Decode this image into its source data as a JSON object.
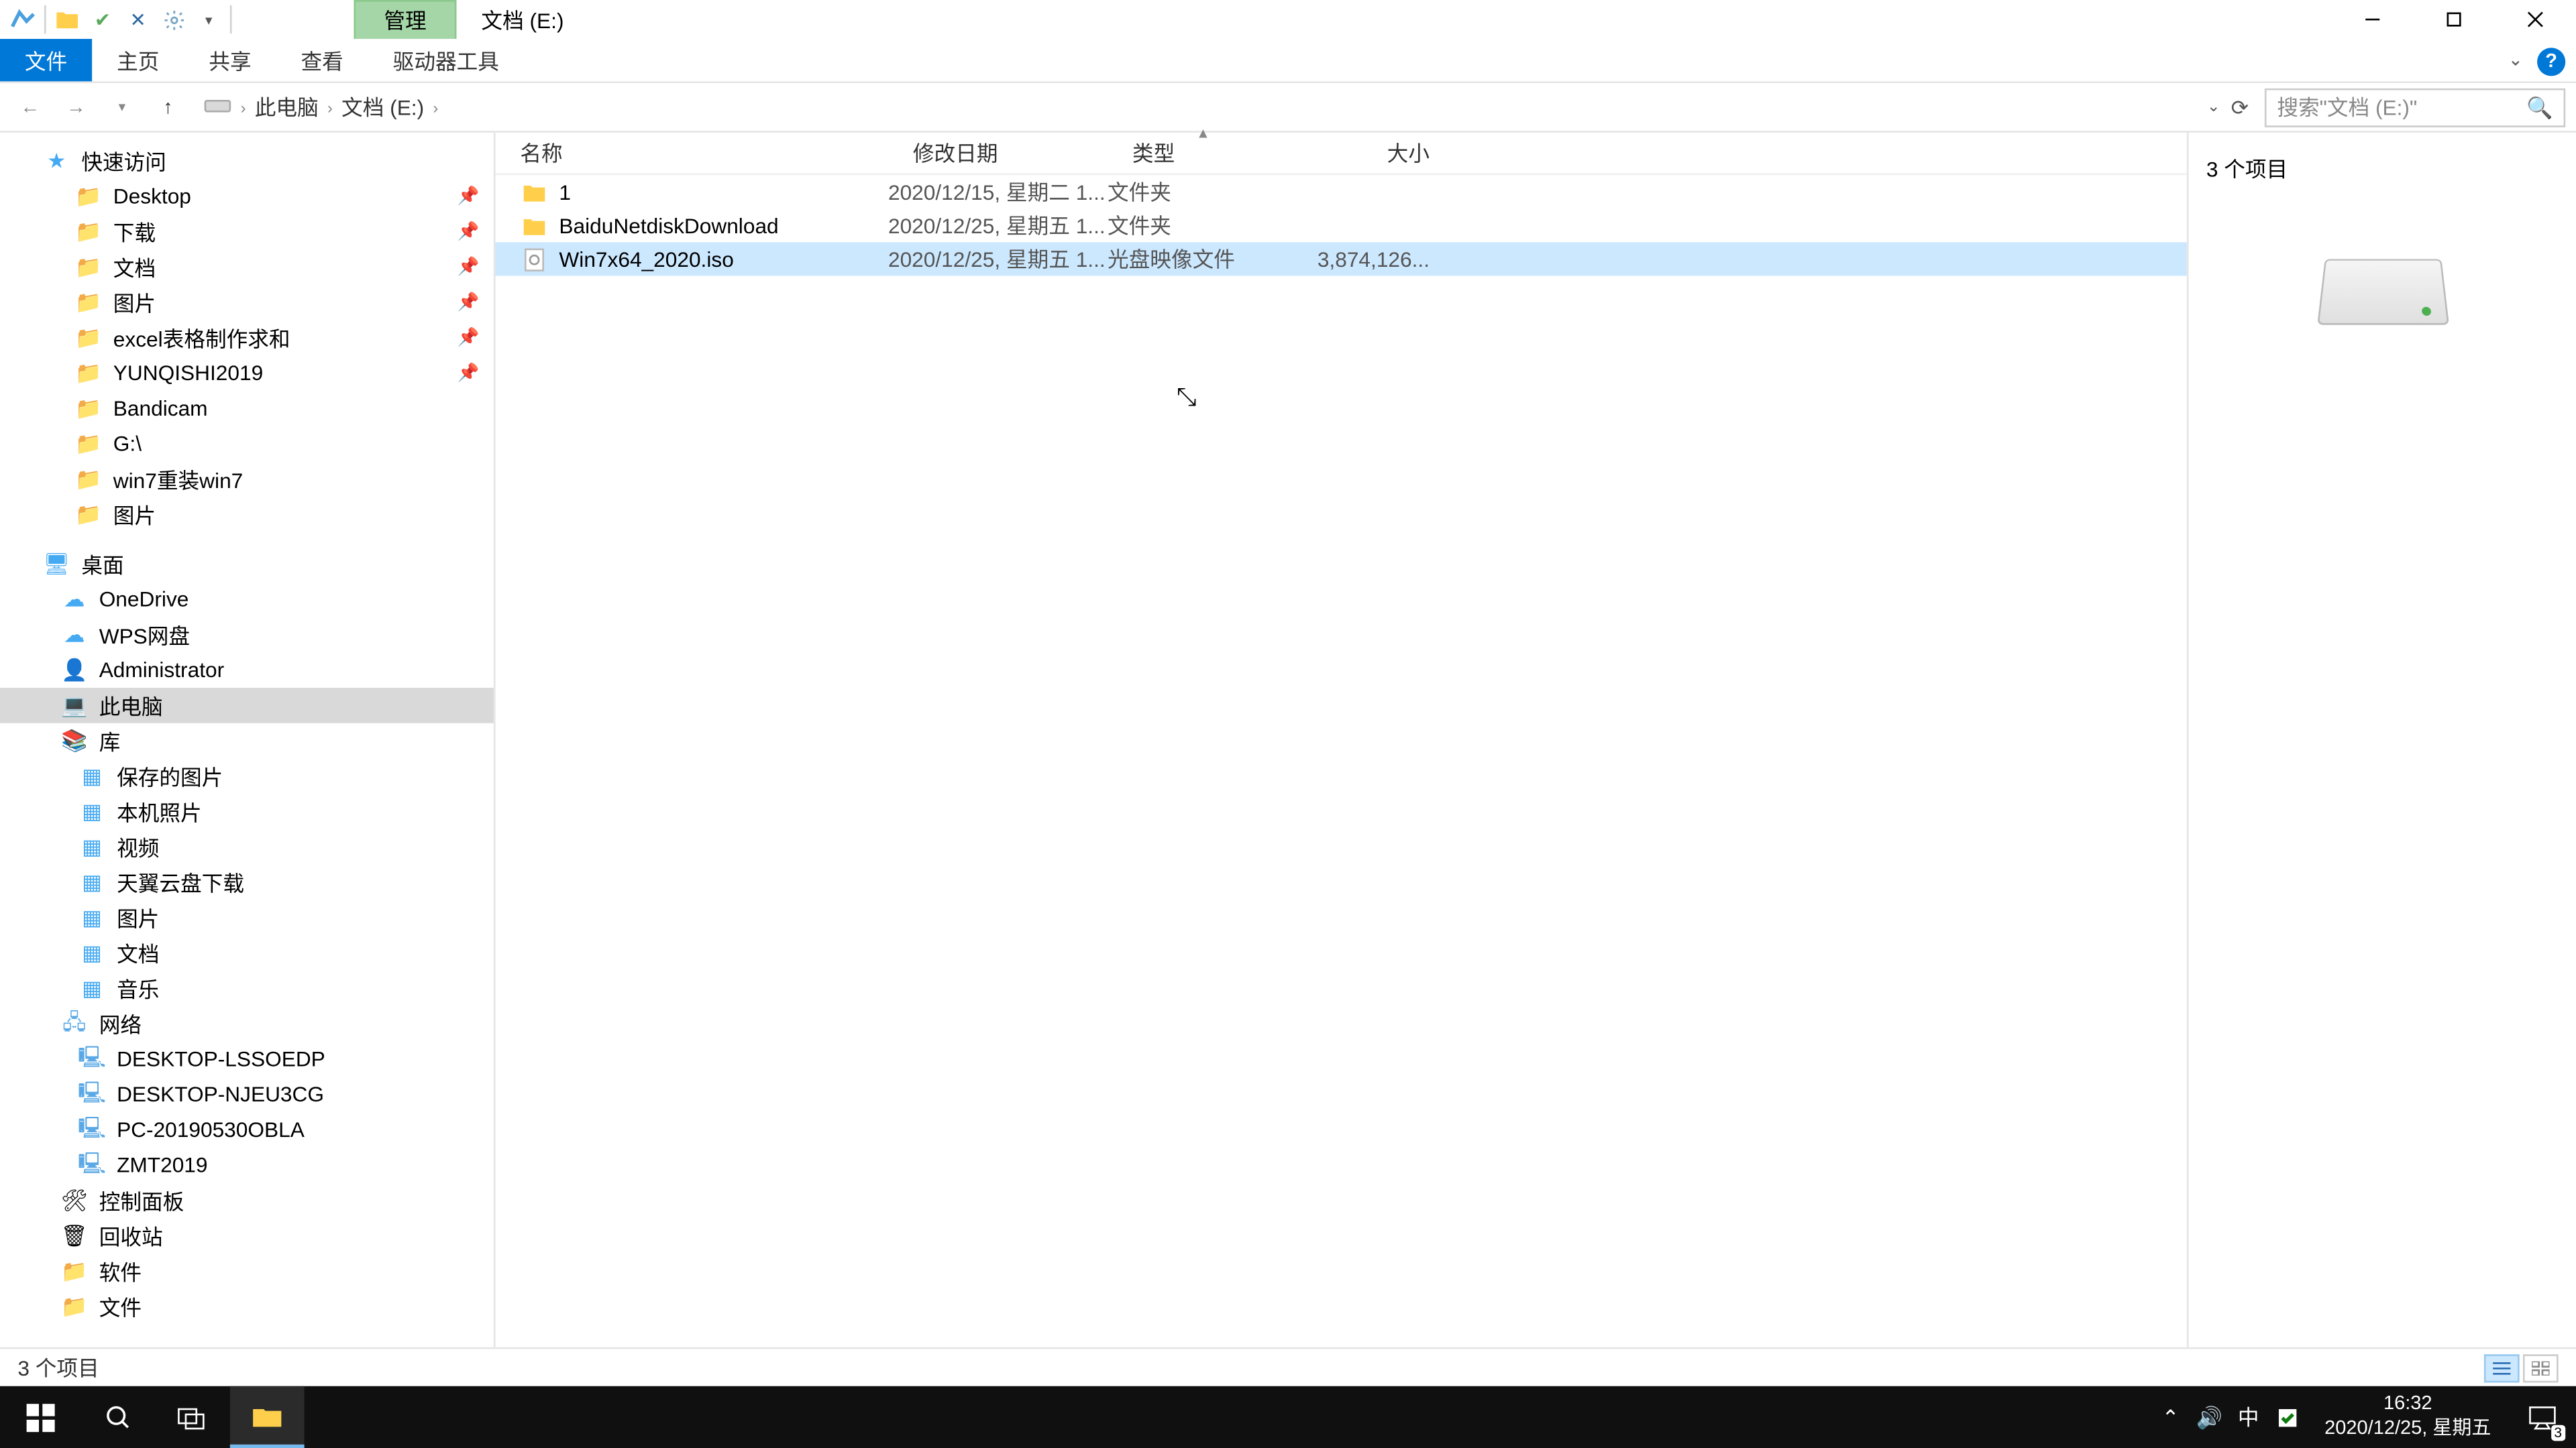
{
  "titlebar": {
    "context_tab": "管理",
    "title": "文档 (E:)"
  },
  "ribbon": {
    "file": "文件",
    "home": "主页",
    "share": "共享",
    "view": "查看",
    "drive_tools": "驱动器工具"
  },
  "breadcrumb": {
    "pc": "此电脑",
    "drive": "文档 (E:)"
  },
  "search": {
    "placeholder": "搜索\"文档 (E:)\""
  },
  "tree": {
    "quick_access": "快速访问",
    "qa_items": [
      {
        "label": "Desktop",
        "icon": "desktop",
        "pin": true
      },
      {
        "label": "下载",
        "icon": "download",
        "pin": true
      },
      {
        "label": "文档",
        "icon": "document",
        "pin": true
      },
      {
        "label": "图片",
        "icon": "pictures",
        "pin": true
      },
      {
        "label": "excel表格制作求和",
        "icon": "folder",
        "pin": true
      },
      {
        "label": "YUNQISHI2019",
        "icon": "folder",
        "pin": true
      },
      {
        "label": "Bandicam",
        "icon": "folder",
        "pin": false
      },
      {
        "label": "G:\\",
        "icon": "drive",
        "pin": false
      },
      {
        "label": "win7重装win7",
        "icon": "folder",
        "pin": false
      },
      {
        "label": "图片",
        "icon": "folder",
        "pin": false
      }
    ],
    "desktop": "桌面",
    "desktop_items": [
      {
        "label": "OneDrive",
        "icon": "onedrive"
      },
      {
        "label": "WPS网盘",
        "icon": "wps"
      },
      {
        "label": "Administrator",
        "icon": "user"
      },
      {
        "label": "此电脑",
        "icon": "pc",
        "selected": true
      },
      {
        "label": "库",
        "icon": "library"
      }
    ],
    "library_items": [
      {
        "label": "保存的图片",
        "icon": "pic"
      },
      {
        "label": "本机照片",
        "icon": "pic"
      },
      {
        "label": "视频",
        "icon": "video"
      },
      {
        "label": "天翼云盘下载",
        "icon": "cloud"
      },
      {
        "label": "图片",
        "icon": "pic"
      },
      {
        "label": "文档",
        "icon": "doc"
      },
      {
        "label": "音乐",
        "icon": "music"
      }
    ],
    "network": "网络",
    "network_items": [
      {
        "label": "DESKTOP-LSSOEDP"
      },
      {
        "label": "DESKTOP-NJEU3CG"
      },
      {
        "label": "PC-20190530OBLA"
      },
      {
        "label": "ZMT2019"
      }
    ],
    "control_panel": "控制面板",
    "recycle": "回收站",
    "software": "软件",
    "files": "文件"
  },
  "columns": {
    "name": "名称",
    "date": "修改日期",
    "type": "类型",
    "size": "大小"
  },
  "rows": [
    {
      "name": "1",
      "date": "2020/12/15, 星期二 1...",
      "type": "文件夹",
      "size": "",
      "icon": "folder"
    },
    {
      "name": "BaiduNetdiskDownload",
      "date": "2020/12/25, 星期五 1...",
      "type": "文件夹",
      "size": "",
      "icon": "folder"
    },
    {
      "name": "Win7x64_2020.iso",
      "date": "2020/12/25, 星期五 1...",
      "type": "光盘映像文件",
      "size": "3,874,126...",
      "icon": "iso",
      "selected": true
    }
  ],
  "preview": {
    "count_label": "3 个项目"
  },
  "status": {
    "text": "3 个项目"
  },
  "taskbar": {
    "time": "16:32",
    "date": "2020/12/25, 星期五",
    "ime": "中",
    "notif_count": "3"
  }
}
